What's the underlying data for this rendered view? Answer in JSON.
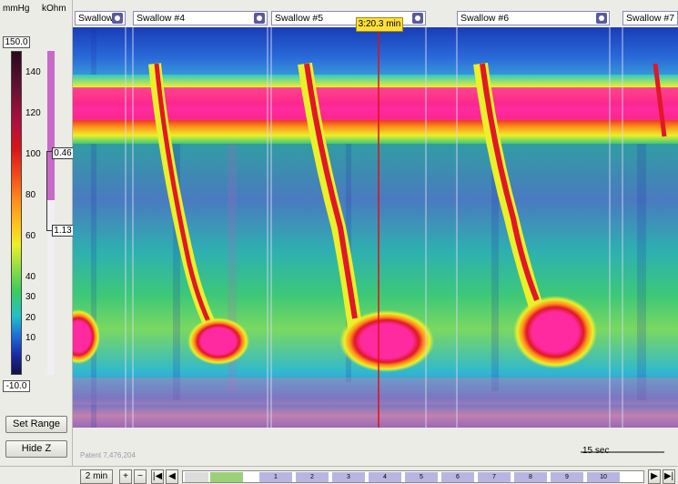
{
  "left_panel": {
    "units": {
      "pressure": "mmHg",
      "impedance": "kOhm"
    },
    "scale_max": "150.0",
    "scale_min": "-10.0",
    "ticks": [
      "140",
      "120",
      "100",
      "80",
      "60",
      "40",
      "30",
      "20",
      "10",
      "0"
    ],
    "z_upper": "0.46",
    "z_lower": "1.13",
    "set_range_label": "Set Range",
    "hide_z_label": "Hide Z"
  },
  "swallows": [
    {
      "label": "Swallow"
    },
    {
      "label": "Swallow #4"
    },
    {
      "label": "Swallow #5"
    },
    {
      "label": "Swallow #6"
    },
    {
      "label": "Swallow #7"
    }
  ],
  "cursor_time": "3:20.3 min",
  "watermark": "Patent 7,476,204",
  "time_scale": "15 sec",
  "toolbar": {
    "zoom_label": "2 min",
    "segment_numbers": [
      "1",
      "2",
      "3",
      "4",
      "5",
      "6",
      "7",
      "8",
      "9",
      "10"
    ]
  },
  "colors": {
    "low": "#1a2ca8",
    "baseline": "#2ea0a0",
    "mid": "#eaf02a",
    "high": "#d81418",
    "peak": "#ff2aa0",
    "cursor_line": "#e01010",
    "swallow_marker": "#8a8ab8"
  }
}
